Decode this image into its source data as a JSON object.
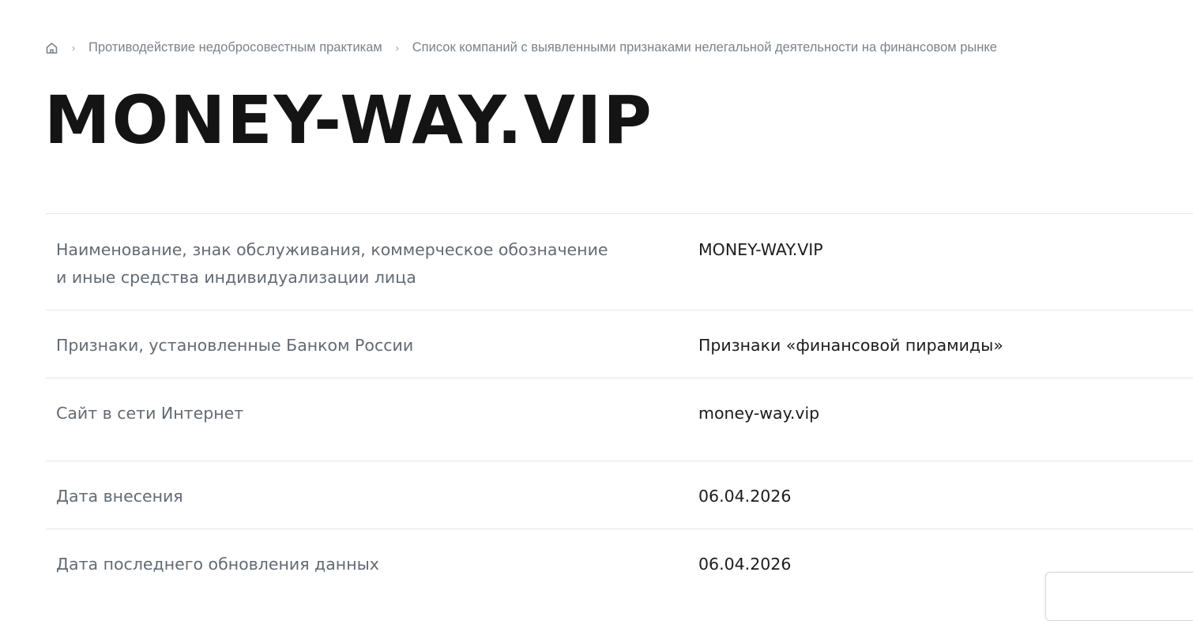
{
  "breadcrumb": {
    "home_icon": "home-icon",
    "separator": "›",
    "items": [
      {
        "label": "Противодействие недобросовестным практикам"
      },
      {
        "label": "Список компаний с выявленными признаками нелегальной деятельности на финансовом рынке"
      }
    ]
  },
  "page": {
    "title": "MONEY-WAY.VIP"
  },
  "details": {
    "rows": [
      {
        "label": "Наименование, знак обслуживания, коммерческое обозначение и иные средства индивидуализации лица",
        "value": "MONEY-WAY.VIP"
      },
      {
        "label": "Признаки, установленные Банком России",
        "value": "Признаки «финансовой пирамиды»"
      },
      {
        "label": "Сайт в сети Интернет",
        "value": "money-way.vip"
      },
      {
        "label": "Дата внесения",
        "value": "06.04.2026"
      },
      {
        "label": "Дата последнего обновления данных",
        "value": "06.04.2026"
      }
    ]
  },
  "colors": {
    "title": "#141414",
    "label": "#636a73",
    "value": "#1c1c1c",
    "breadcrumb": "#7a828c",
    "divider": "#e4e6e9"
  }
}
